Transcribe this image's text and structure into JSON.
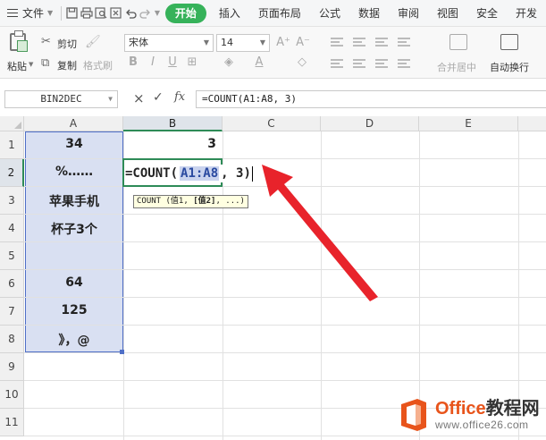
{
  "menubar": {
    "file_label": "文件",
    "tabs": [
      "开始",
      "插入",
      "页面布局",
      "公式",
      "数据",
      "审阅",
      "视图",
      "安全",
      "开发"
    ],
    "active_tab": "开始"
  },
  "ribbon": {
    "paste": "粘贴",
    "cut": "剪切",
    "copy": "复制",
    "format_painter": "格式刷",
    "font_name": "宋体",
    "font_size": "14",
    "merge_center": "合并居中",
    "wrap_text": "自动换行"
  },
  "formula_bar": {
    "name_box": "BIN2DEC",
    "cancel_icon": "×",
    "confirm_icon": "✓",
    "fx_label": "fx",
    "formula": "=COUNT(A1:A8, 3)"
  },
  "sheet": {
    "columns": [
      "A",
      "B",
      "C",
      "D",
      "E"
    ],
    "rows": [
      "1",
      "2",
      "3",
      "4",
      "5",
      "6",
      "7",
      "8",
      "9",
      "10",
      "11"
    ],
    "column_a_values": [
      "34",
      "%……",
      "苹果手机",
      "杯子3个",
      "",
      "64",
      "125",
      "》，@"
    ],
    "b1_value": "3",
    "edit": {
      "prefix": "=COUNT(",
      "ref": "A1:A8",
      "suffix": ", 3)"
    },
    "tooltip": {
      "func": "COUNT (值1, ",
      "bold": "[值2]",
      "rest": ", ...)"
    },
    "range_color": "#d9e0f2",
    "active_cell_color": "#2e8b57"
  },
  "logo": {
    "brand_en": "Office",
    "brand_cn": "教程网",
    "url": "www.office26.com",
    "color": "#e8541b"
  },
  "annotation": {
    "arrow_color": "#e8232b"
  }
}
